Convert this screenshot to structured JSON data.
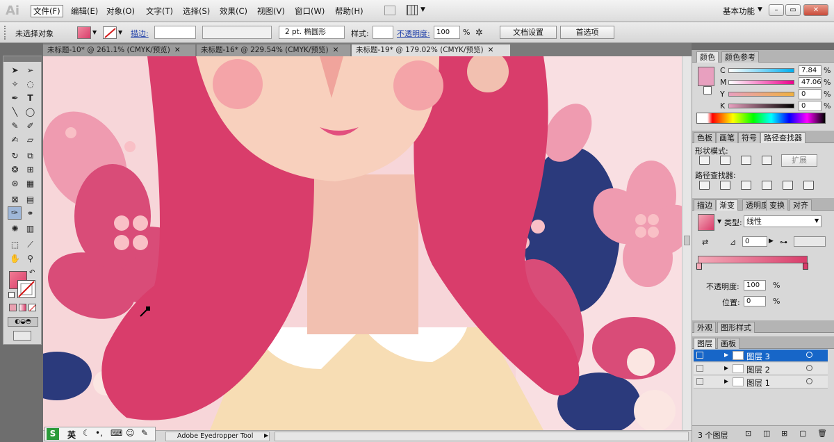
{
  "app": {
    "logo": "Ai",
    "workspace": "基本功能"
  },
  "menu": [
    "文件(F)",
    "编辑(E)",
    "对象(O)",
    "文字(T)",
    "选择(S)",
    "效果(C)",
    "视图(V)",
    "窗口(W)",
    "帮助(H)"
  ],
  "control": {
    "selection": "未选择对象",
    "stroke_label": "描边:",
    "stroke_value": "2 pt. 椭圆形",
    "style_label": "样式:",
    "opacity_label": "不透明度:",
    "opacity_value": "100",
    "opacity_unit": "%",
    "doc_settings": "文档设置",
    "preferences": "首选项"
  },
  "tabs": [
    "未标题-10* @ 261.1% (CMYK/预览)",
    "未标题-16* @ 229.54% (CMYK/预览)",
    "未标题-19* @ 179.02% (CMYK/预览)"
  ],
  "status": {
    "tool": "Adobe Eyedropper Tool"
  },
  "ime": {
    "lang": "英"
  },
  "color_panel": {
    "tabs": [
      "颜色",
      "颜色参考"
    ],
    "channels": [
      {
        "k": "C",
        "v": "7.84",
        "pct": "%"
      },
      {
        "k": "M",
        "v": "47.06",
        "pct": "%"
      },
      {
        "k": "Y",
        "v": "0",
        "pct": "%"
      },
      {
        "k": "K",
        "v": "0",
        "pct": "%"
      }
    ],
    "swatch": "#e8a0bf"
  },
  "pathfinder": {
    "tabs": [
      "色板",
      "画笔",
      "符号",
      "路径查找器"
    ],
    "shape_modes": "形状模式:",
    "expand": "扩展",
    "pathfinders": "路径查找器:"
  },
  "gradient": {
    "tabs": [
      "描边",
      "渐变",
      "透明度",
      "变换",
      "对齐"
    ],
    "type_label": "类型:",
    "type_value": "线性",
    "angle": "0",
    "opacity_label": "不透明度:",
    "opacity_value": "100",
    "opacity_unit": "%",
    "location_label": "位置:",
    "location_value": "0",
    "location_unit": "%"
  },
  "appearance": {
    "tabs": [
      "外观",
      "图形样式"
    ]
  },
  "layers": {
    "tabs": [
      "图层",
      "画板"
    ],
    "rows": [
      "图层 3",
      "图层 2",
      "图层 1"
    ],
    "count": "3 个图层"
  },
  "colors": {
    "hair": "#d93d6b",
    "skin": "#f8d0bd",
    "navy": "#2b3a7c",
    "flower": "#ef9bb0"
  }
}
